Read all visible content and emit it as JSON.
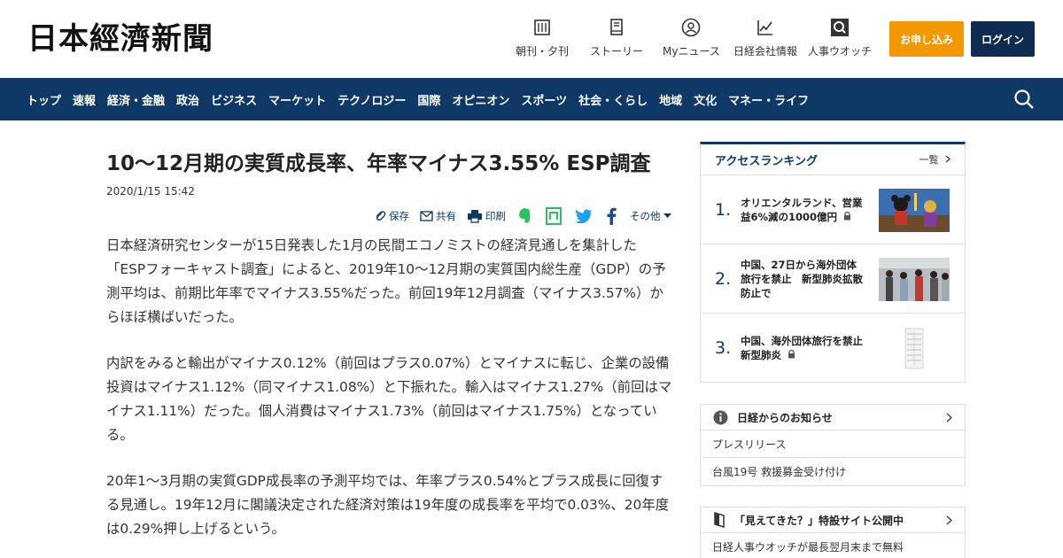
{
  "header": {
    "logo": "日本經濟新聞",
    "nav": [
      {
        "label": "朝刊・夕刊",
        "icon": "newspaper-icon"
      },
      {
        "label": "ストーリー",
        "icon": "story-icon"
      },
      {
        "label": "Myニュース",
        "icon": "person-icon"
      },
      {
        "label": "日経会社情報",
        "icon": "chart-icon"
      },
      {
        "label": "人事ウオッチ",
        "icon": "search-book-icon"
      }
    ],
    "apply_label": "お申し込み",
    "login_label": "ログイン"
  },
  "categories": [
    "トップ",
    "速報",
    "経済・金融",
    "政治",
    "ビジネス",
    "マーケット",
    "テクノロジー",
    "国際",
    "オピニオン",
    "スポーツ",
    "社会・くらし",
    "地域",
    "文化",
    "マネー・ライフ"
  ],
  "article": {
    "title": "10～12月期の実質成長率、年率マイナス3.55% ESP調査",
    "date": "2020/1/15 15:42",
    "share": {
      "save": "保存",
      "share": "共有",
      "print": "印刷",
      "more": "その他"
    },
    "paragraphs": [
      "日本経済研究センターが15日発表した1月の民間エコノミストの経済見通しを集計した「ESPフォーキャスト調査」によると、2019年10～12月期の実質国内総生産（GDP）の予測平均は、前期比年率でマイナス3.55%だった。前回19年12月調査（マイナス3.57%）からほぼ横ばいだった。",
      "内訳をみると輸出がマイナス0.12%（前回はプラス0.07%）とマイナスに転じ、企業の設備投資はマイナス1.12%（同マイナス1.08%）と下振れた。輸入はマイナス1.27%（前回はマイナス1.11%）だった。個人消費はマイナス1.73%（前回はマイナス1.75%）となっている。",
      "20年1～3月期の実質GDP成長率の予測平均では、年率プラス0.54%とプラス成長に回復する見通し。19年12月に閣議決定された経済対策は19年度の成長率を平均で0.03%、20年度は0.29%押し上げるという。"
    ]
  },
  "sidebar": {
    "ranking": {
      "title": "アクセスランキング",
      "more": "一覧",
      "items": [
        {
          "num": "1.",
          "text": "オリエンタルランド、営業益6%減の1000億円"
        },
        {
          "num": "2.",
          "text": "中国、27日から海外団体旅行を禁止　新型肺炎拡散防止で"
        },
        {
          "num": "3.",
          "text": "中国、海外団体旅行を禁止　新型肺炎"
        }
      ]
    },
    "notice": {
      "title": "日経からのお知らせ",
      "items": [
        "プレスリリース",
        "台風19号 救援募金受け付け"
      ]
    },
    "special": {
      "title": "「見えてきた？」特設サイト公開中",
      "items": [
        "日経人事ウオッチが最長翌月末まで無料"
      ]
    }
  },
  "colors": {
    "navy": "#0e3967",
    "login_bg": "#0e2b52",
    "apply_bg": "#f39800"
  }
}
